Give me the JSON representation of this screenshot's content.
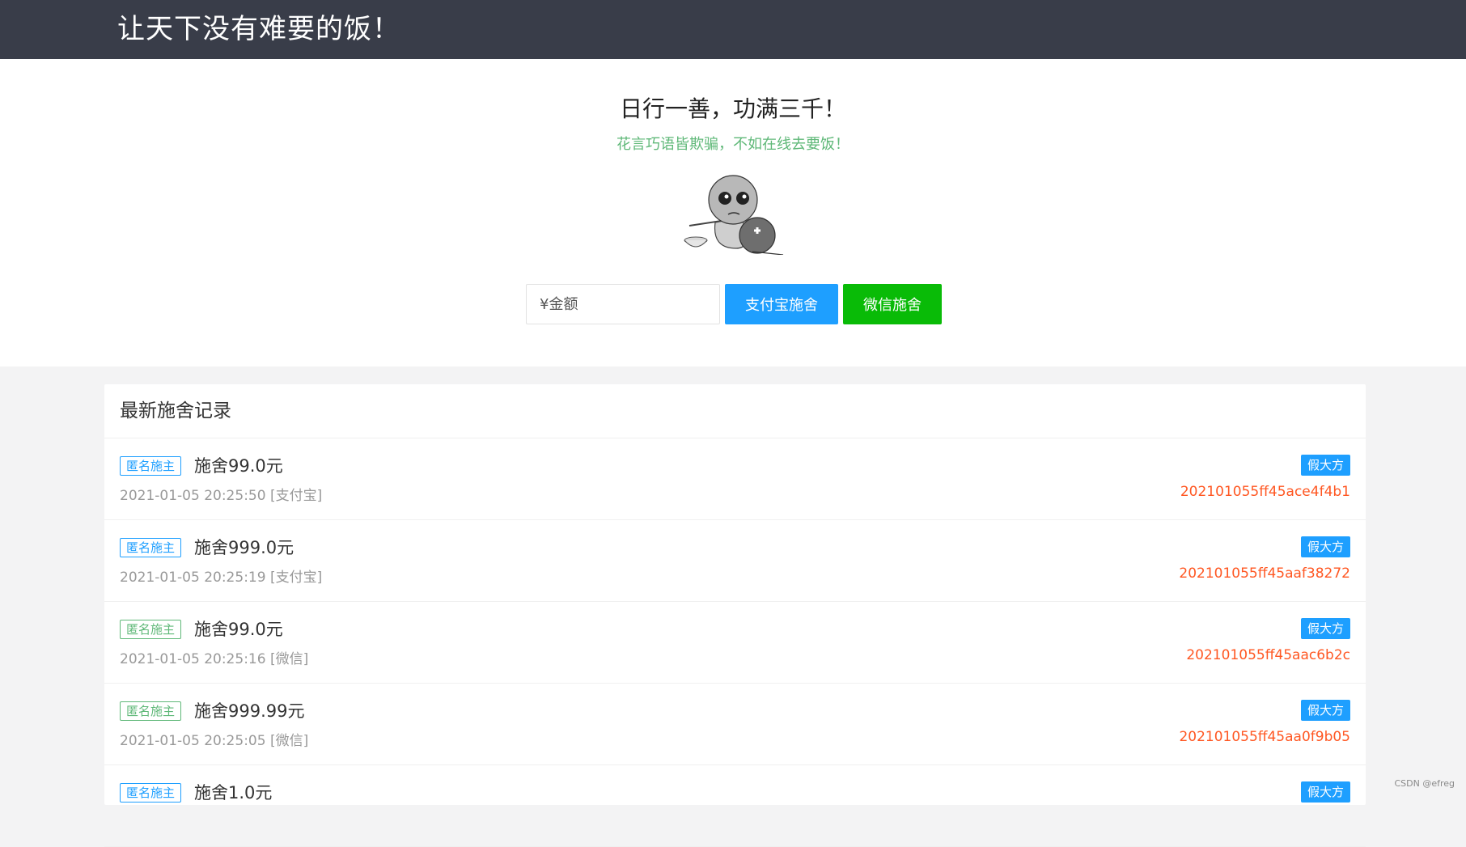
{
  "header": {
    "brand": "让天下没有难要的饭！"
  },
  "hero": {
    "title": "日行一善，功满三千！",
    "subtitle": "花言巧语皆欺骗，不如在线去要饭！",
    "amount_placeholder": "¥金额",
    "alipay_label": "支付宝施舍",
    "wechat_label": "微信施舍"
  },
  "records": {
    "title": "最新施舍记录",
    "items": [
      {
        "donor_tag": "匿名施主",
        "amount": "施舍99.0元",
        "meta": "2021-01-05 20:25:50 [支付宝]",
        "badge": "假大方",
        "order_no": "202101055ff45ace4f4b1"
      },
      {
        "donor_tag": "匿名施主",
        "amount": "施舍999.0元",
        "meta": "2021-01-05 20:25:19 [支付宝]",
        "badge": "假大方",
        "order_no": "202101055ff45aaf38272"
      },
      {
        "donor_tag": "匿名施主",
        "amount": "施舍99.0元",
        "meta": "2021-01-05 20:25:16 [微信]",
        "badge": "假大方",
        "order_no": "202101055ff45aac6b2c"
      },
      {
        "donor_tag": "匿名施主",
        "amount": "施舍999.99元",
        "meta": "2021-01-05 20:25:05 [微信]",
        "badge": "假大方",
        "order_no": "202101055ff45aa0f9b05"
      },
      {
        "donor_tag": "匿名施主",
        "amount": "施舍1.0元",
        "meta": "",
        "badge": "假大方",
        "order_no": ""
      }
    ]
  },
  "watermark": "CSDN @efreg",
  "colors": {
    "header_bg": "#393d49",
    "alipay_blue": "#1e9fff",
    "wechat_green": "#09bb07",
    "subtitle_green": "#5fb878",
    "order_orange": "#ff5722"
  }
}
